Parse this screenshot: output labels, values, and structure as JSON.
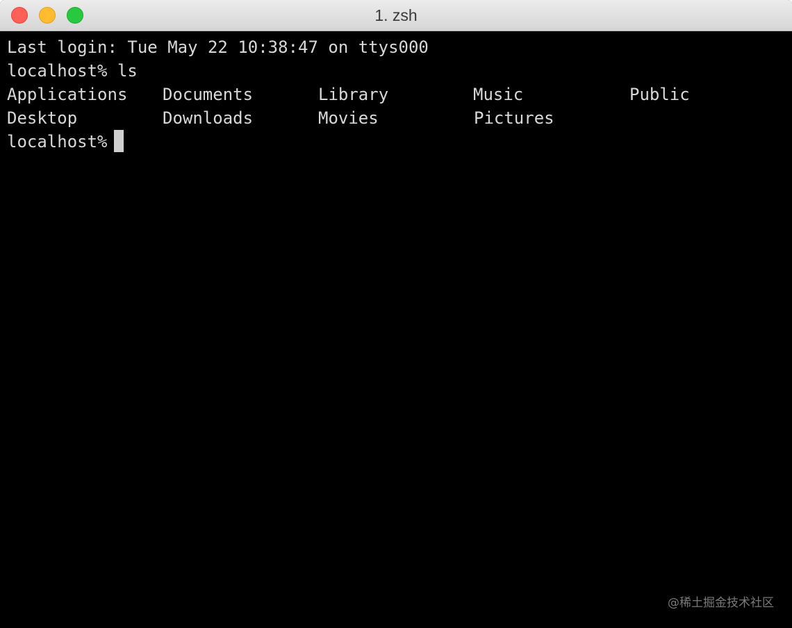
{
  "window": {
    "title": "1. zsh"
  },
  "terminal": {
    "last_login": "Last login: Tue May 22 10:38:47 on ttys000",
    "command_line": "localhost% ls",
    "ls_row1": [
      "Applications",
      "Documents",
      "Library",
      "Music",
      "Public"
    ],
    "ls_row2": [
      "Desktop",
      "Downloads",
      "Movies",
      "Pictures"
    ],
    "prompt": "localhost% "
  },
  "watermark": "@稀土掘金技术社区",
  "colors": {
    "background": "#000000",
    "text": "#d8d8d8",
    "cursor": "#cfcfcf",
    "close_button": "#fe5f57",
    "minimize_button": "#febc2e",
    "zoom_button": "#28c840"
  }
}
